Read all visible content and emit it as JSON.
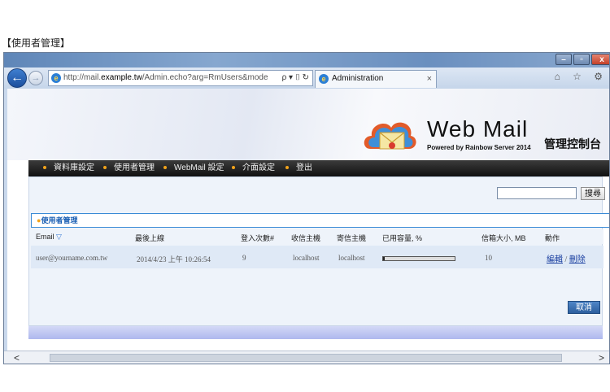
{
  "caption": "【使用者管理】",
  "browser": {
    "url_prefix": "http://mail.",
    "url_domain": "example.tw",
    "url_rest": "/Admin.echo?arg=RmUsers&mode",
    "url_tools": "ρ ▾ ⌷ ↻",
    "tab_title": "Administration",
    "tab_close": "×",
    "toolbar_right": "⌂ ☆ ⚙"
  },
  "banner": {
    "brand": "Web Mail",
    "powered": "Powered by Rainbow Server 2014",
    "console": "管理控制台"
  },
  "menu": [
    "資料庫設定",
    "使用者管理",
    "WebMail 設定",
    "介面設定",
    "登出"
  ],
  "search": {
    "button": "搜尋",
    "value": ""
  },
  "panel": {
    "title": "使用者管理"
  },
  "table": {
    "headers": [
      "Email",
      "最後上線",
      "登入次數#",
      "收信主機",
      "寄信主機",
      "已用容量, %",
      "信箱大小, MB",
      "動作"
    ],
    "row": {
      "email": "user@yourname.com.tw",
      "last_login": "2014/4/23 上午 10:26:54",
      "login_count": "9",
      "recv_host": "localhost",
      "send_host": "localhost",
      "usage_percent": 1,
      "mailbox_size": "10",
      "edit": "編輯",
      "sep": " / ",
      "delete": "刪除"
    }
  },
  "cancel_label": "取消",
  "colors": {
    "accent": "#f2a31b",
    "link": "#1a3fa0",
    "title_blue": "#1a5fb4"
  }
}
